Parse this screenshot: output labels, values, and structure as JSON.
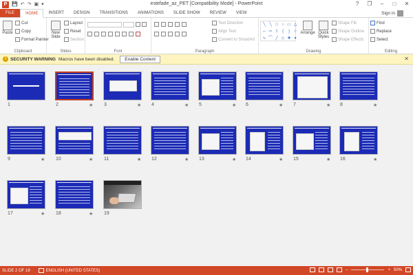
{
  "window": {
    "title": "estefade_az_PET [Compatibility Mode] - PowerPoint",
    "controls": [
      "?",
      "❐",
      "–",
      "□",
      "✕"
    ]
  },
  "qat": [
    "P",
    "💾",
    "↶",
    "↷",
    "▣",
    "▾"
  ],
  "tabs": [
    {
      "label": "FILE"
    },
    {
      "label": "HOME"
    },
    {
      "label": "INSERT"
    },
    {
      "label": "DESIGN"
    },
    {
      "label": "TRANSITIONS"
    },
    {
      "label": "ANIMATIONS"
    },
    {
      "label": "SLIDE SHOW"
    },
    {
      "label": "REVIEW"
    },
    {
      "label": "VIEW"
    }
  ],
  "active_tab": "HOME",
  "signin": "Sign in",
  "ribbon": {
    "clipboard": {
      "label": "Clipboard",
      "paste": "Paste",
      "cut": "Cut",
      "copy": "Copy",
      "format_painter": "Format Painter"
    },
    "slides": {
      "label": "Slides",
      "new_slide": "New Slide",
      "layout": "Layout",
      "reset": "Reset",
      "section": "Section"
    },
    "font": {
      "label": "Font"
    },
    "paragraph": {
      "label": "Paragraph",
      "text_direction": "Text Direction",
      "align_text": "Align Text",
      "convert_smartart": "Convert to SmartArt"
    },
    "drawing": {
      "label": "Drawing",
      "arrange": "Arrange",
      "quick_styles": "Quick Styles",
      "shape_fill": "Shape Fill",
      "shape_outline": "Shape Outline",
      "shape_effects": "Shape Effects"
    },
    "editing": {
      "label": "Editing",
      "find": "Find",
      "replace": "Replace",
      "select": "Select"
    }
  },
  "security_bar": {
    "title": "SECURITY WARNING",
    "message": "Macros have been disabled.",
    "button": "Enable Content",
    "icon": "warning-icon"
  },
  "slides": [
    {
      "n": "1",
      "star": false,
      "type": "title"
    },
    {
      "n": "2",
      "star": true,
      "type": "text",
      "selected": true
    },
    {
      "n": "3",
      "star": true,
      "type": "diagram"
    },
    {
      "n": "4",
      "star": true,
      "type": "text"
    },
    {
      "n": "5",
      "star": true,
      "type": "chart"
    },
    {
      "n": "6",
      "star": true,
      "type": "text"
    },
    {
      "n": "7",
      "star": true,
      "type": "chart-white"
    },
    {
      "n": "8",
      "star": true,
      "type": "text"
    },
    {
      "n": "9",
      "star": true,
      "type": "text"
    },
    {
      "n": "10",
      "star": true,
      "type": "table"
    },
    {
      "n": "11",
      "star": true,
      "type": "text"
    },
    {
      "n": "12",
      "star": true,
      "type": "text"
    },
    {
      "n": "13",
      "star": true,
      "type": "chart"
    },
    {
      "n": "14",
      "star": true,
      "type": "chart2"
    },
    {
      "n": "15",
      "star": true,
      "type": "chart"
    },
    {
      "n": "16",
      "star": true,
      "type": "chart2"
    },
    {
      "n": "17",
      "star": true,
      "type": "chart"
    },
    {
      "n": "18",
      "star": true,
      "type": "text"
    },
    {
      "n": "19",
      "star": false,
      "type": "photo"
    }
  ],
  "status": {
    "slide_count": "SLIDE 2 OF 19",
    "language": "ENGLISH (UNITED STATES)",
    "zoom": "50%"
  },
  "colors": {
    "accent": "#d24726",
    "slide_bg": "#1c2bb5",
    "warning_bg": "#fdf4bf"
  }
}
